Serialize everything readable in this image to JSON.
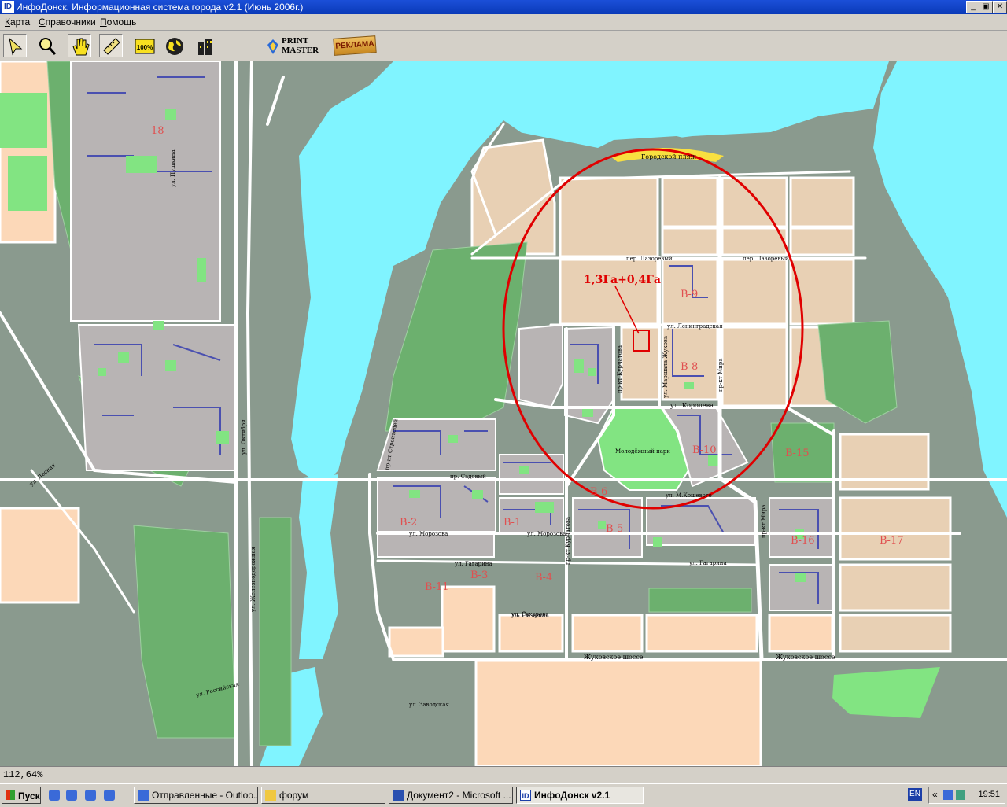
{
  "window": {
    "title": "ИнфоДонск. Информационная система города v2.1 (Июнь 2006г.)",
    "app_icon": "ID",
    "controls": {
      "minimize": "_",
      "maximize": "▣",
      "close": "✕"
    }
  },
  "menu": [
    {
      "label": "Карта"
    },
    {
      "label": "Справочники"
    },
    {
      "label": "Помощь"
    }
  ],
  "toolbar": {
    "tools": [
      {
        "icon": "arrow-pointer-icon",
        "active": true
      },
      {
        "icon": "magnifier-icon"
      },
      {
        "icon": "hand-pan-icon",
        "active": true
      },
      {
        "icon": "ruler-icon",
        "active": true
      },
      {
        "icon": "zoom-100-icon",
        "label": "100%"
      },
      {
        "icon": "globe-icon"
      },
      {
        "icon": "buildings-icon"
      }
    ],
    "print_master": {
      "line1": "PRINT",
      "line2": "MASTER"
    },
    "ad": "РЕКЛАМА",
    "back_icon": "arrow-left-icon"
  },
  "map": {
    "annotation": "1,3Га+0,4Га",
    "park": "Молодёжный парк",
    "beach": "Городской пляж",
    "districts": [
      "В-17",
      "В-16",
      "В-15",
      "В-9",
      "В-8",
      "В-10",
      "В-11",
      "В-6",
      "В-5",
      "В-4",
      "В-3",
      "В-2",
      "В-1",
      "18"
    ],
    "streets": [
      "пр-кт Курчатова",
      "пр-кт Мира",
      "ул. Королева",
      "ул. Маршала Жукова",
      "ул. М.Кошевого",
      "ул. Морозова",
      "ул. Гагарина",
      "ул. Сахарова",
      "пр. Садовый",
      "пр-кт Мира",
      "Жуковское шоссе",
      "Жуковское шоссе",
      "пер. Лазоревый",
      "пер. Лазоревый",
      "ул. Ленинградская",
      "пр-кт Курчатова",
      "ул. Морозова",
      "ул. Гагарина",
      "ул. Гагарина",
      "пр-кт Строителей",
      "ул. Железнодорожная",
      "ул. Октября",
      "ул. Пушкина",
      "ул. Заводская",
      "ул. Лесная",
      "ул. Российская"
    ]
  },
  "status": {
    "zoom": "112,64%"
  },
  "taskbar": {
    "start": "Пуск",
    "tasks": [
      {
        "label": "Отправленные - Outloo..."
      },
      {
        "label": "форум"
      },
      {
        "label": "Документ2 - Microsoft ..."
      },
      {
        "label": "ИнфоДонск v2.1",
        "active": true
      }
    ],
    "lang": "EN",
    "time": "19:51"
  },
  "colors": {
    "water": "#80f4ff",
    "background": "#8a9a8e",
    "block": "#e8d0b4",
    "suburb": "#fcd8b8",
    "park": "#82e482",
    "private_housing": "#6cb06e",
    "circle": "#e00000",
    "beach": "#f8e040"
  }
}
